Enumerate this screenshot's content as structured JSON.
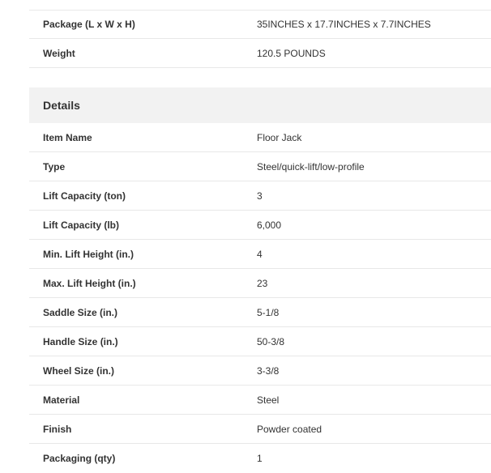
{
  "package_section": {
    "rows": [
      {
        "label": "Package (L x W x H)",
        "value": "35INCHES x 17.7INCHES x 7.7INCHES"
      },
      {
        "label": "Weight",
        "value": "120.5 POUNDS"
      }
    ]
  },
  "details_section": {
    "title": "Details",
    "rows": [
      {
        "label": "Item Name",
        "value": "Floor Jack"
      },
      {
        "label": "Type",
        "value": "Steel/quick-lift/low-profile"
      },
      {
        "label": "Lift Capacity (ton)",
        "value": "3"
      },
      {
        "label": "Lift Capacity (lb)",
        "value": "6,000"
      },
      {
        "label": "Min. Lift Height (in.)",
        "value": "4"
      },
      {
        "label": "Max. Lift Height (in.)",
        "value": "23"
      },
      {
        "label": "Saddle Size (in.)",
        "value": "5-1/8"
      },
      {
        "label": "Handle Size (in.)",
        "value": "50-3/8"
      },
      {
        "label": "Wheel Size (in.)",
        "value": "3-3/8"
      },
      {
        "label": "Material",
        "value": "Steel"
      },
      {
        "label": "Finish",
        "value": "Powder coated"
      },
      {
        "label": "Packaging (qty)",
        "value": "1"
      }
    ]
  }
}
